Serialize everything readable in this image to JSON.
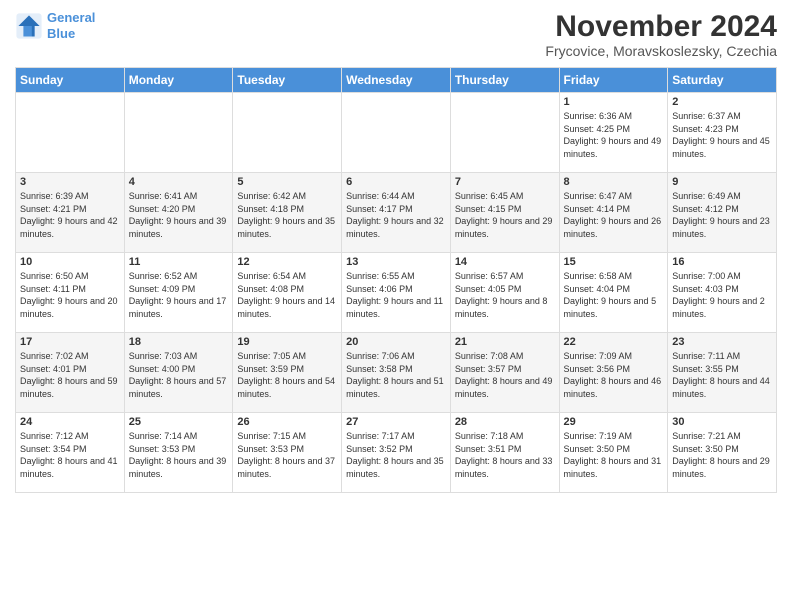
{
  "header": {
    "logo_line1": "General",
    "logo_line2": "Blue",
    "month": "November 2024",
    "location": "Frycovice, Moravskoslezsky, Czechia"
  },
  "days_of_week": [
    "Sunday",
    "Monday",
    "Tuesday",
    "Wednesday",
    "Thursday",
    "Friday",
    "Saturday"
  ],
  "weeks": [
    [
      {
        "day": "",
        "info": ""
      },
      {
        "day": "",
        "info": ""
      },
      {
        "day": "",
        "info": ""
      },
      {
        "day": "",
        "info": ""
      },
      {
        "day": "",
        "info": ""
      },
      {
        "day": "1",
        "info": "Sunrise: 6:36 AM\nSunset: 4:25 PM\nDaylight: 9 hours and 49 minutes."
      },
      {
        "day": "2",
        "info": "Sunrise: 6:37 AM\nSunset: 4:23 PM\nDaylight: 9 hours and 45 minutes."
      }
    ],
    [
      {
        "day": "3",
        "info": "Sunrise: 6:39 AM\nSunset: 4:21 PM\nDaylight: 9 hours and 42 minutes."
      },
      {
        "day": "4",
        "info": "Sunrise: 6:41 AM\nSunset: 4:20 PM\nDaylight: 9 hours and 39 minutes."
      },
      {
        "day": "5",
        "info": "Sunrise: 6:42 AM\nSunset: 4:18 PM\nDaylight: 9 hours and 35 minutes."
      },
      {
        "day": "6",
        "info": "Sunrise: 6:44 AM\nSunset: 4:17 PM\nDaylight: 9 hours and 32 minutes."
      },
      {
        "day": "7",
        "info": "Sunrise: 6:45 AM\nSunset: 4:15 PM\nDaylight: 9 hours and 29 minutes."
      },
      {
        "day": "8",
        "info": "Sunrise: 6:47 AM\nSunset: 4:14 PM\nDaylight: 9 hours and 26 minutes."
      },
      {
        "day": "9",
        "info": "Sunrise: 6:49 AM\nSunset: 4:12 PM\nDaylight: 9 hours and 23 minutes."
      }
    ],
    [
      {
        "day": "10",
        "info": "Sunrise: 6:50 AM\nSunset: 4:11 PM\nDaylight: 9 hours and 20 minutes."
      },
      {
        "day": "11",
        "info": "Sunrise: 6:52 AM\nSunset: 4:09 PM\nDaylight: 9 hours and 17 minutes."
      },
      {
        "day": "12",
        "info": "Sunrise: 6:54 AM\nSunset: 4:08 PM\nDaylight: 9 hours and 14 minutes."
      },
      {
        "day": "13",
        "info": "Sunrise: 6:55 AM\nSunset: 4:06 PM\nDaylight: 9 hours and 11 minutes."
      },
      {
        "day": "14",
        "info": "Sunrise: 6:57 AM\nSunset: 4:05 PM\nDaylight: 9 hours and 8 minutes."
      },
      {
        "day": "15",
        "info": "Sunrise: 6:58 AM\nSunset: 4:04 PM\nDaylight: 9 hours and 5 minutes."
      },
      {
        "day": "16",
        "info": "Sunrise: 7:00 AM\nSunset: 4:03 PM\nDaylight: 9 hours and 2 minutes."
      }
    ],
    [
      {
        "day": "17",
        "info": "Sunrise: 7:02 AM\nSunset: 4:01 PM\nDaylight: 8 hours and 59 minutes."
      },
      {
        "day": "18",
        "info": "Sunrise: 7:03 AM\nSunset: 4:00 PM\nDaylight: 8 hours and 57 minutes."
      },
      {
        "day": "19",
        "info": "Sunrise: 7:05 AM\nSunset: 3:59 PM\nDaylight: 8 hours and 54 minutes."
      },
      {
        "day": "20",
        "info": "Sunrise: 7:06 AM\nSunset: 3:58 PM\nDaylight: 8 hours and 51 minutes."
      },
      {
        "day": "21",
        "info": "Sunrise: 7:08 AM\nSunset: 3:57 PM\nDaylight: 8 hours and 49 minutes."
      },
      {
        "day": "22",
        "info": "Sunrise: 7:09 AM\nSunset: 3:56 PM\nDaylight: 8 hours and 46 minutes."
      },
      {
        "day": "23",
        "info": "Sunrise: 7:11 AM\nSunset: 3:55 PM\nDaylight: 8 hours and 44 minutes."
      }
    ],
    [
      {
        "day": "24",
        "info": "Sunrise: 7:12 AM\nSunset: 3:54 PM\nDaylight: 8 hours and 41 minutes."
      },
      {
        "day": "25",
        "info": "Sunrise: 7:14 AM\nSunset: 3:53 PM\nDaylight: 8 hours and 39 minutes."
      },
      {
        "day": "26",
        "info": "Sunrise: 7:15 AM\nSunset: 3:53 PM\nDaylight: 8 hours and 37 minutes."
      },
      {
        "day": "27",
        "info": "Sunrise: 7:17 AM\nSunset: 3:52 PM\nDaylight: 8 hours and 35 minutes."
      },
      {
        "day": "28",
        "info": "Sunrise: 7:18 AM\nSunset: 3:51 PM\nDaylight: 8 hours and 33 minutes."
      },
      {
        "day": "29",
        "info": "Sunrise: 7:19 AM\nSunset: 3:50 PM\nDaylight: 8 hours and 31 minutes."
      },
      {
        "day": "30",
        "info": "Sunrise: 7:21 AM\nSunset: 3:50 PM\nDaylight: 8 hours and 29 minutes."
      }
    ]
  ]
}
